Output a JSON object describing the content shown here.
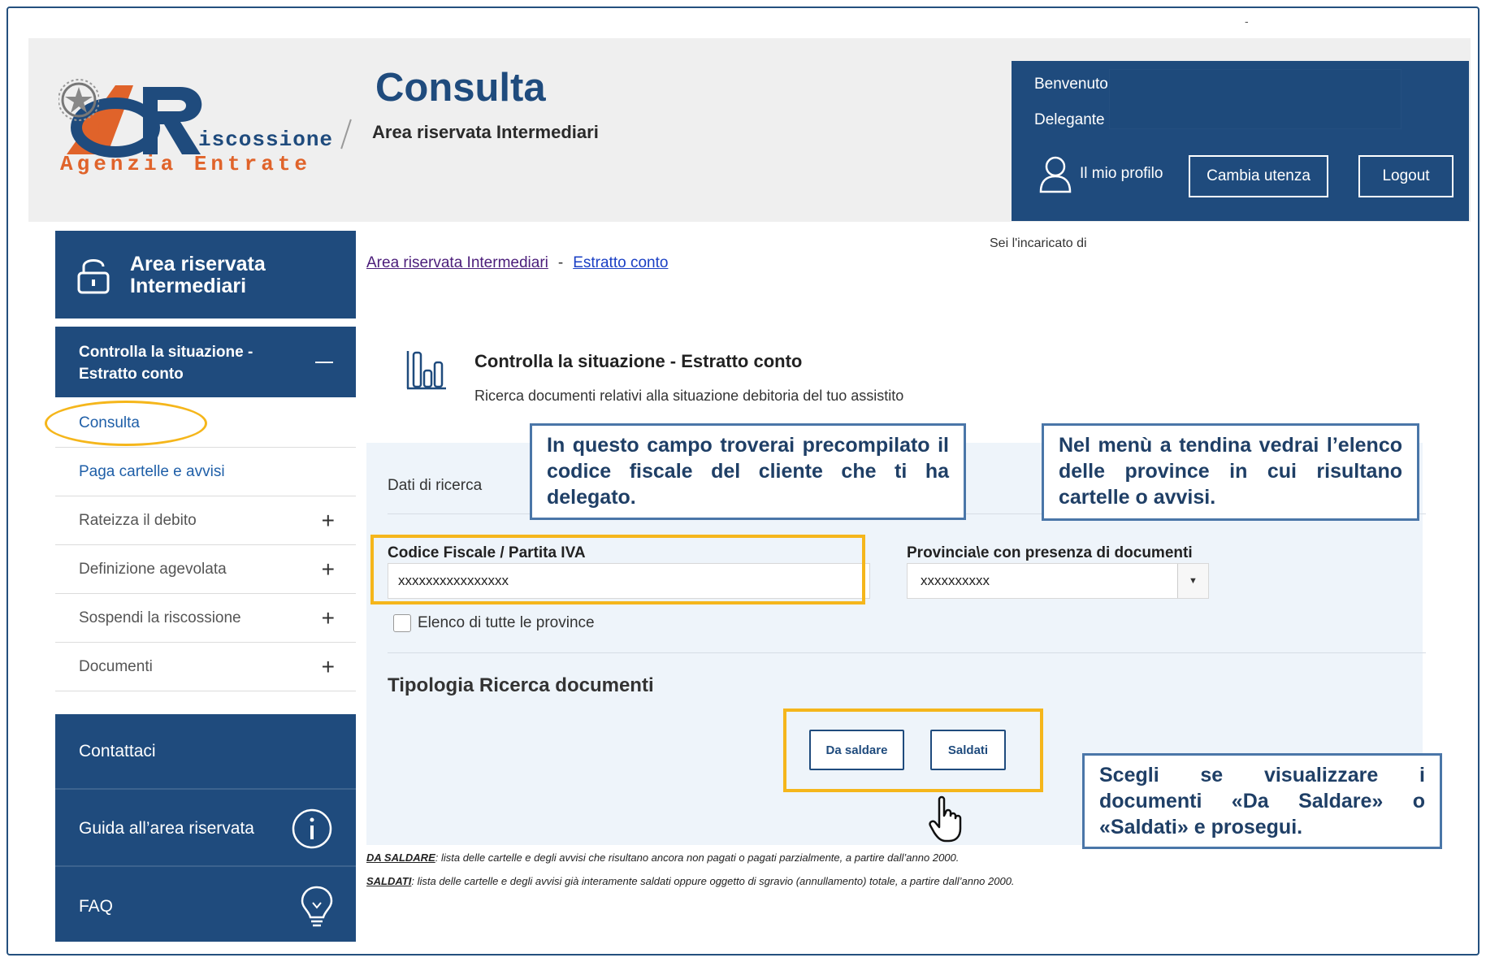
{
  "header": {
    "logo_word": "iscossione",
    "logo_agency": "Agenzia Entrate",
    "title": "Consulta",
    "subtitle": "Area riservata Intermediari",
    "corner_mark": "-"
  },
  "user_panel": {
    "welcome": "Benvenuto",
    "delegante": "Delegante",
    "profile": "Il mio profilo",
    "change_user": "Cambia utenza",
    "logout": "Logout",
    "incaricato": "Sei l'incaricato di"
  },
  "sidebar": {
    "area": "Area riservata Intermediari",
    "section": "Controlla la situazione - Estratto conto",
    "items": [
      {
        "label": "Consulta"
      },
      {
        "label": "Paga cartelle e avvisi"
      },
      {
        "label": "Rateizza il debito"
      },
      {
        "label": "Definizione agevolata"
      },
      {
        "label": "Sospendi la riscossione"
      },
      {
        "label": "Documenti"
      }
    ],
    "bottom": [
      {
        "label": "Contattaci"
      },
      {
        "label": "Guida all’area riservata"
      },
      {
        "label": "FAQ"
      }
    ]
  },
  "breadcrumb": {
    "first": "Area riservata Intermediari",
    "separator": "-",
    "current": "Estratto conto"
  },
  "content": {
    "title": "Controlla la situazione - Estratto conto",
    "description": "Ricerca documenti relativi alla situazione debitoria del tuo assistito"
  },
  "search": {
    "section_label": "Dati di ricerca",
    "cf_label": "Codice Fiscale / Partita IVA",
    "cf_value": "xxxxxxxxxxxxxxxx",
    "province_label": "Provincia\\e con presenza di documenti",
    "province_value": "xxxxxxxxxx",
    "all_provinces": "Elenco di tutte le province",
    "all_provinces_checked": false,
    "type_title": "Tipologia Ricerca documenti",
    "btn_da_saldare": "Da saldare",
    "btn_saldati": "Saldati"
  },
  "notes": {
    "da_saldare_key": "DA SALDARE",
    "da_saldare_text": ": lista delle cartelle e degli avvisi che risultano ancora non pagati o pagati parzialmente, a partire dall’anno 2000.",
    "saldati_key": "SALDATI",
    "saldati_text": ": lista delle cartelle e degli avvisi già interamente saldati oppure oggetto di sgravio (annullamento) totale, a partire dall’anno 2000."
  },
  "callouts": {
    "cf": "In questo campo troverai precompilato il codice fiscale del cliente che ti ha delegato.",
    "province": "Nel menù a tendina vedrai l’elenco delle province in cui risultano cartelle o avvisi.",
    "buttons": "Scegli se visualizzare i documenti «Da Saldare» o «Saldati» e prosegui."
  },
  "colors": {
    "brand_blue": "#1f4b7d",
    "highlight_yellow": "#f5b61b",
    "logo_orange": "#e0632a",
    "callout_border": "#4a76a8",
    "panel_bg": "#eef4fa"
  },
  "icons": [
    "lock-icon",
    "user-icon",
    "chart-icon",
    "info-icon",
    "lightbulb-icon",
    "hand-pointer-icon",
    "chevron-down-icon",
    "plus-icon",
    "minus-icon"
  ]
}
